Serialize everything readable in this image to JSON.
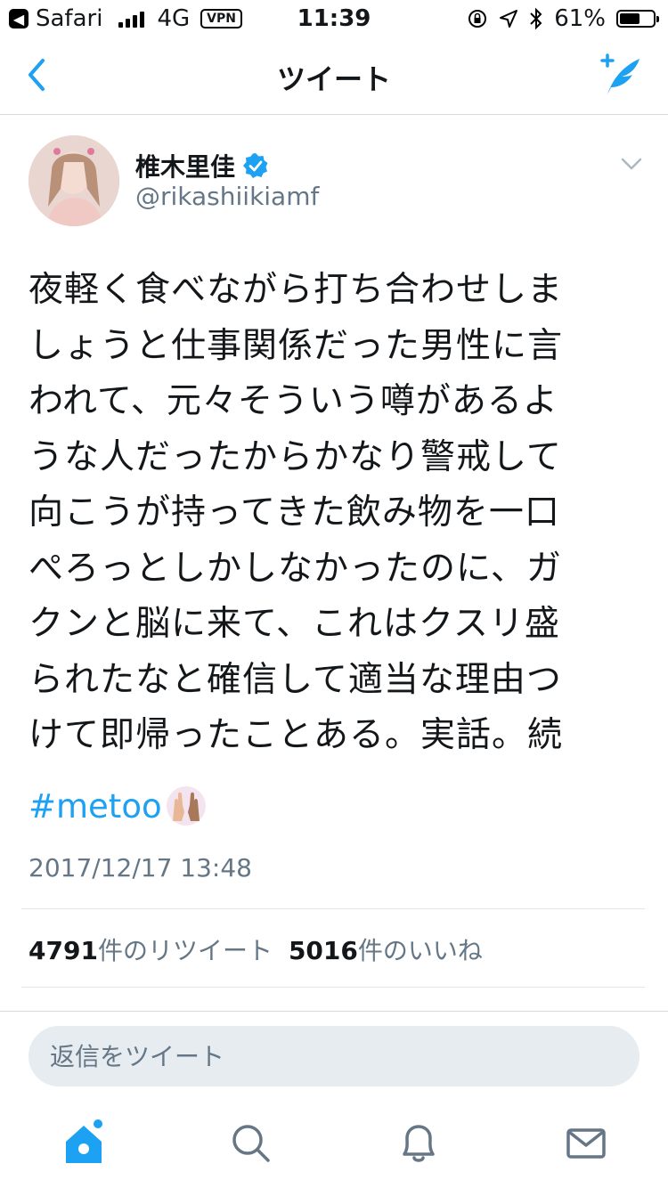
{
  "status_bar": {
    "back_app": "Safari",
    "network": "4G",
    "vpn": "VPN",
    "time": "11:39",
    "battery": "61%",
    "battery_level": 0.61
  },
  "nav": {
    "title": "ツイート"
  },
  "tweet": {
    "author_name": "椎木里佳",
    "author_handle": "@rikashiikiamf",
    "text_lines": [
      "夜軽く食べながら打ち合わせしま",
      "しょうと仕事関係だった男性に言",
      "われて、元々そういう噂があるよ",
      "うな人だったからかなり警戒して",
      "向こうが持ってきた飲み物を一口",
      "ぺろっとしかしなかったのに、ガ",
      "クンと脳に来て、これはクスリ盛",
      "られたなと確信して適当な理由つ",
      "けて即帰ったことある。実話。続"
    ],
    "hashtag": "#metoo",
    "timestamp": "2017/12/17 13:48",
    "retweet_count": "4791",
    "retweet_label": "件のリツイート",
    "like_count": "5016",
    "like_label": "件のいいね"
  },
  "reply": {
    "placeholder": "返信をツイート"
  },
  "colors": {
    "accent": "#1da1f2",
    "secondary_text": "#657786",
    "primary_text": "#14171a"
  }
}
